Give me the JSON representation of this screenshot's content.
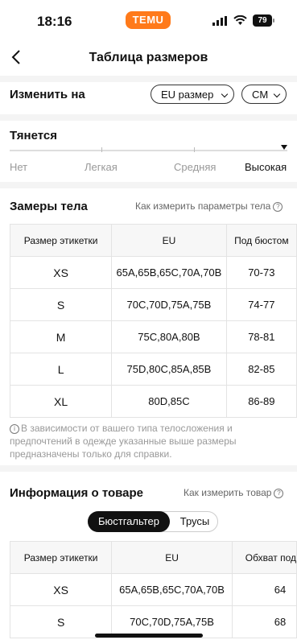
{
  "status_bar": {
    "time": "18:16",
    "app_badge": "TEMU",
    "battery": "79"
  },
  "nav": {
    "title": "Таблица размеров"
  },
  "change_units": {
    "label": "Изменить на",
    "region_select": "EU размер",
    "unit_select": "CM"
  },
  "stretch": {
    "title": "Тянется",
    "levels": [
      "Нет",
      "Легкая",
      "Средняя",
      "Высокая"
    ],
    "selected": "Высокая"
  },
  "body_measurements": {
    "title": "Замеры тела",
    "link": "Как измерить параметры тела",
    "columns": [
      "Размер этикетки",
      "EU",
      "Под бюстом"
    ],
    "rows": [
      [
        "XS",
        "65A,65B,65C,70A,70B",
        "70-73"
      ],
      [
        "S",
        "70C,70D,75A,75B",
        "74-77"
      ],
      [
        "M",
        "75C,80A,80B",
        "78-81"
      ],
      [
        "L",
        "75D,80C,85A,85B",
        "82-85"
      ],
      [
        "XL",
        "80D,85C",
        "86-89"
      ]
    ],
    "note": "В зависимости от вашего типа телосложения и предпочтений в одежде указанные выше размеры предназначены только для справки."
  },
  "product_info": {
    "title": "Информация о товаре",
    "link": "Как измерить товар",
    "tabs": [
      "Бюстгальтер",
      "Трусы"
    ],
    "active_tab": "Бюстгальтер",
    "columns": [
      "Размер этикетки",
      "EU",
      "Обхват под"
    ],
    "rows": [
      [
        "XS",
        "65A,65B,65C,70A,70B",
        "64"
      ],
      [
        "S",
        "70C,70D,75A,75B",
        "68"
      ]
    ]
  }
}
